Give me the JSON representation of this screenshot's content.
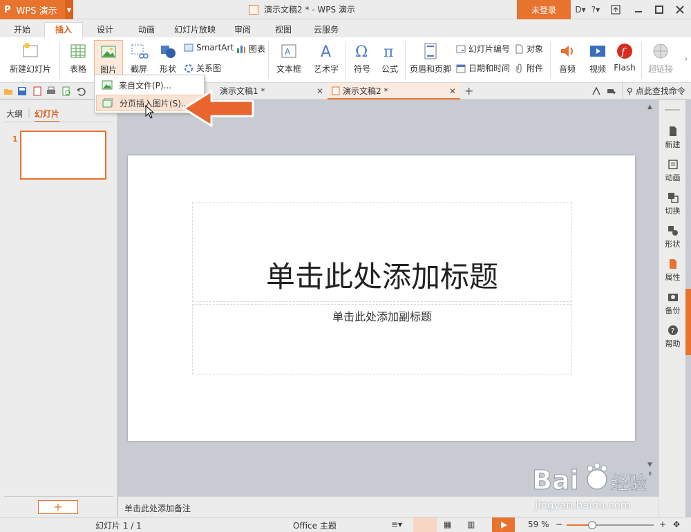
{
  "app": {
    "logo": "P",
    "name": "WPS 演示",
    "window_title": "演示文稿2 * - WPS 演示",
    "login_label": "未登录"
  },
  "titlebar_icons": {
    "skin": "D▾",
    "help": "?▾"
  },
  "menu_tabs": [
    {
      "label": "开始"
    },
    {
      "label": "插入"
    },
    {
      "label": "设计"
    },
    {
      "label": "动画"
    },
    {
      "label": "幻灯片放映"
    },
    {
      "label": "审阅"
    },
    {
      "label": "视图"
    },
    {
      "label": "云服务"
    }
  ],
  "active_tab": "插入",
  "ribbon": {
    "new_slide": "新建幻灯片",
    "table": "表格",
    "picture": "图片",
    "screenshot": "截屏",
    "shape": "形状",
    "smartart": "SmartArt",
    "chart": "图表",
    "relation": "关系图",
    "textbox": "文本框",
    "wordart": "艺术字",
    "symbol": "符号",
    "formula": "公式",
    "header_footer": "页眉和页脚",
    "slide_number": "幻灯片编号",
    "object": "对象",
    "datetime": "日期和时间",
    "attachment": "附件",
    "audio": "音频",
    "video": "视频",
    "flash": "Flash",
    "hyperlink": "超链接"
  },
  "doc_tabs": [
    {
      "label": "演示文稿1 *"
    },
    {
      "label": "演示文稿2 *"
    }
  ],
  "command_search": "点此查找命令",
  "left_panel": {
    "tab_outline": "大纲",
    "tab_slides": "幻灯片",
    "slide_number": "1",
    "add_label": "+"
  },
  "slide": {
    "title_placeholder": "单击此处添加标题",
    "subtitle_placeholder": "单击此处添加副标题"
  },
  "notes_placeholder": "单击此处添加备注",
  "right_rail": [
    {
      "label": "新建"
    },
    {
      "label": "动画"
    },
    {
      "label": "切换"
    },
    {
      "label": "形状"
    },
    {
      "label": "属性"
    },
    {
      "label": "备份"
    },
    {
      "label": "帮助"
    }
  ],
  "statusbar": {
    "slide_info": "幻灯片 1 / 1",
    "theme": "Office 主题",
    "zoom": "59 %",
    "zoom_level": 0.59
  },
  "dropdown": {
    "items": [
      {
        "label": "来自文件(P)..."
      },
      {
        "label": "分页插入图片(S)..."
      }
    ]
  },
  "watermark": {
    "brand": "Bai 经验",
    "url": "jingyan.baidu.com"
  },
  "colors": {
    "accent": "#e8732e",
    "chrome": "#ececec",
    "canvas": "#c8ccd2"
  }
}
